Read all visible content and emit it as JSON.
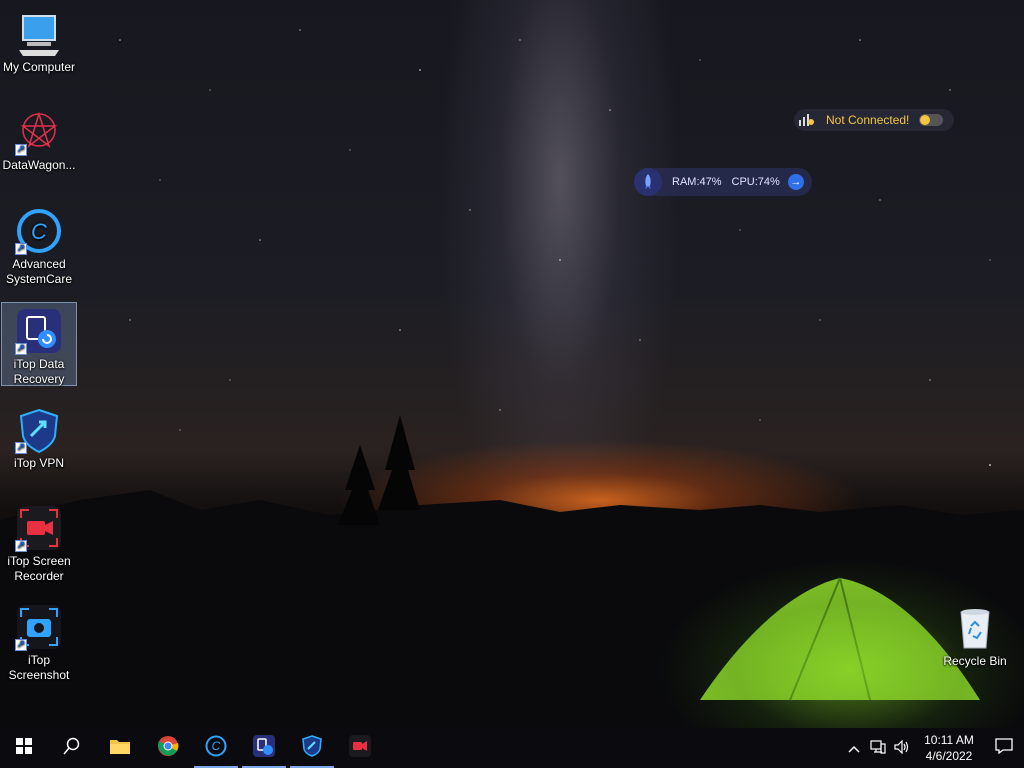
{
  "desktop": {
    "icons": [
      {
        "label": "My Computer",
        "icon": "computer-icon"
      },
      {
        "label": "DataWagon...",
        "icon": "datawagon-icon"
      },
      {
        "label": "Advanced SystemCare",
        "icon": "advanced-systemcare-icon"
      },
      {
        "label": "iTop Data Recovery",
        "icon": "itop-data-recovery-icon"
      },
      {
        "label": "iTop VPN",
        "icon": "itop-vpn-icon"
      },
      {
        "label": "iTop Screen Recorder",
        "icon": "itop-screen-recorder-icon"
      },
      {
        "label": "iTop Screenshot",
        "icon": "itop-screenshot-icon"
      }
    ],
    "recycle_bin": {
      "label": "Recycle Bin",
      "icon": "recycle-bin-icon"
    }
  },
  "vpn_widget": {
    "status": "Not Connected!",
    "color": "#f5c542"
  },
  "perf_widget": {
    "ram": "RAM:47%",
    "cpu": "CPU:74%"
  },
  "taskbar": {
    "apps": [
      {
        "name": "start",
        "icon": "windows-start-icon"
      },
      {
        "name": "search",
        "icon": "search-icon"
      },
      {
        "name": "file-explorer",
        "icon": "folder-icon"
      },
      {
        "name": "chrome",
        "icon": "chrome-icon"
      },
      {
        "name": "advanced-systemcare",
        "icon": "advanced-systemcare-icon"
      },
      {
        "name": "itop-data-recovery",
        "icon": "itop-data-recovery-icon"
      },
      {
        "name": "itop-vpn",
        "icon": "itop-vpn-icon"
      },
      {
        "name": "itop-screen-recorder",
        "icon": "itop-screen-recorder-icon"
      }
    ],
    "clock": {
      "time": "10:11 AM",
      "date": "4/6/2022"
    }
  }
}
